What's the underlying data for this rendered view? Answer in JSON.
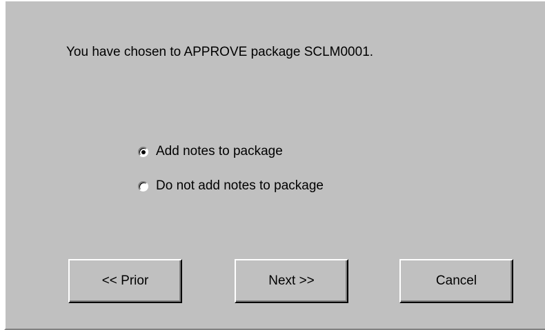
{
  "dialog": {
    "message": "You have chosen to APPROVE package SCLM0001.",
    "options": [
      {
        "label": "Add notes to package",
        "selected": true
      },
      {
        "label": "Do not add notes to package",
        "selected": false
      }
    ],
    "buttons": {
      "prior": "<< Prior",
      "next": "Next >>",
      "cancel": "Cancel"
    }
  }
}
